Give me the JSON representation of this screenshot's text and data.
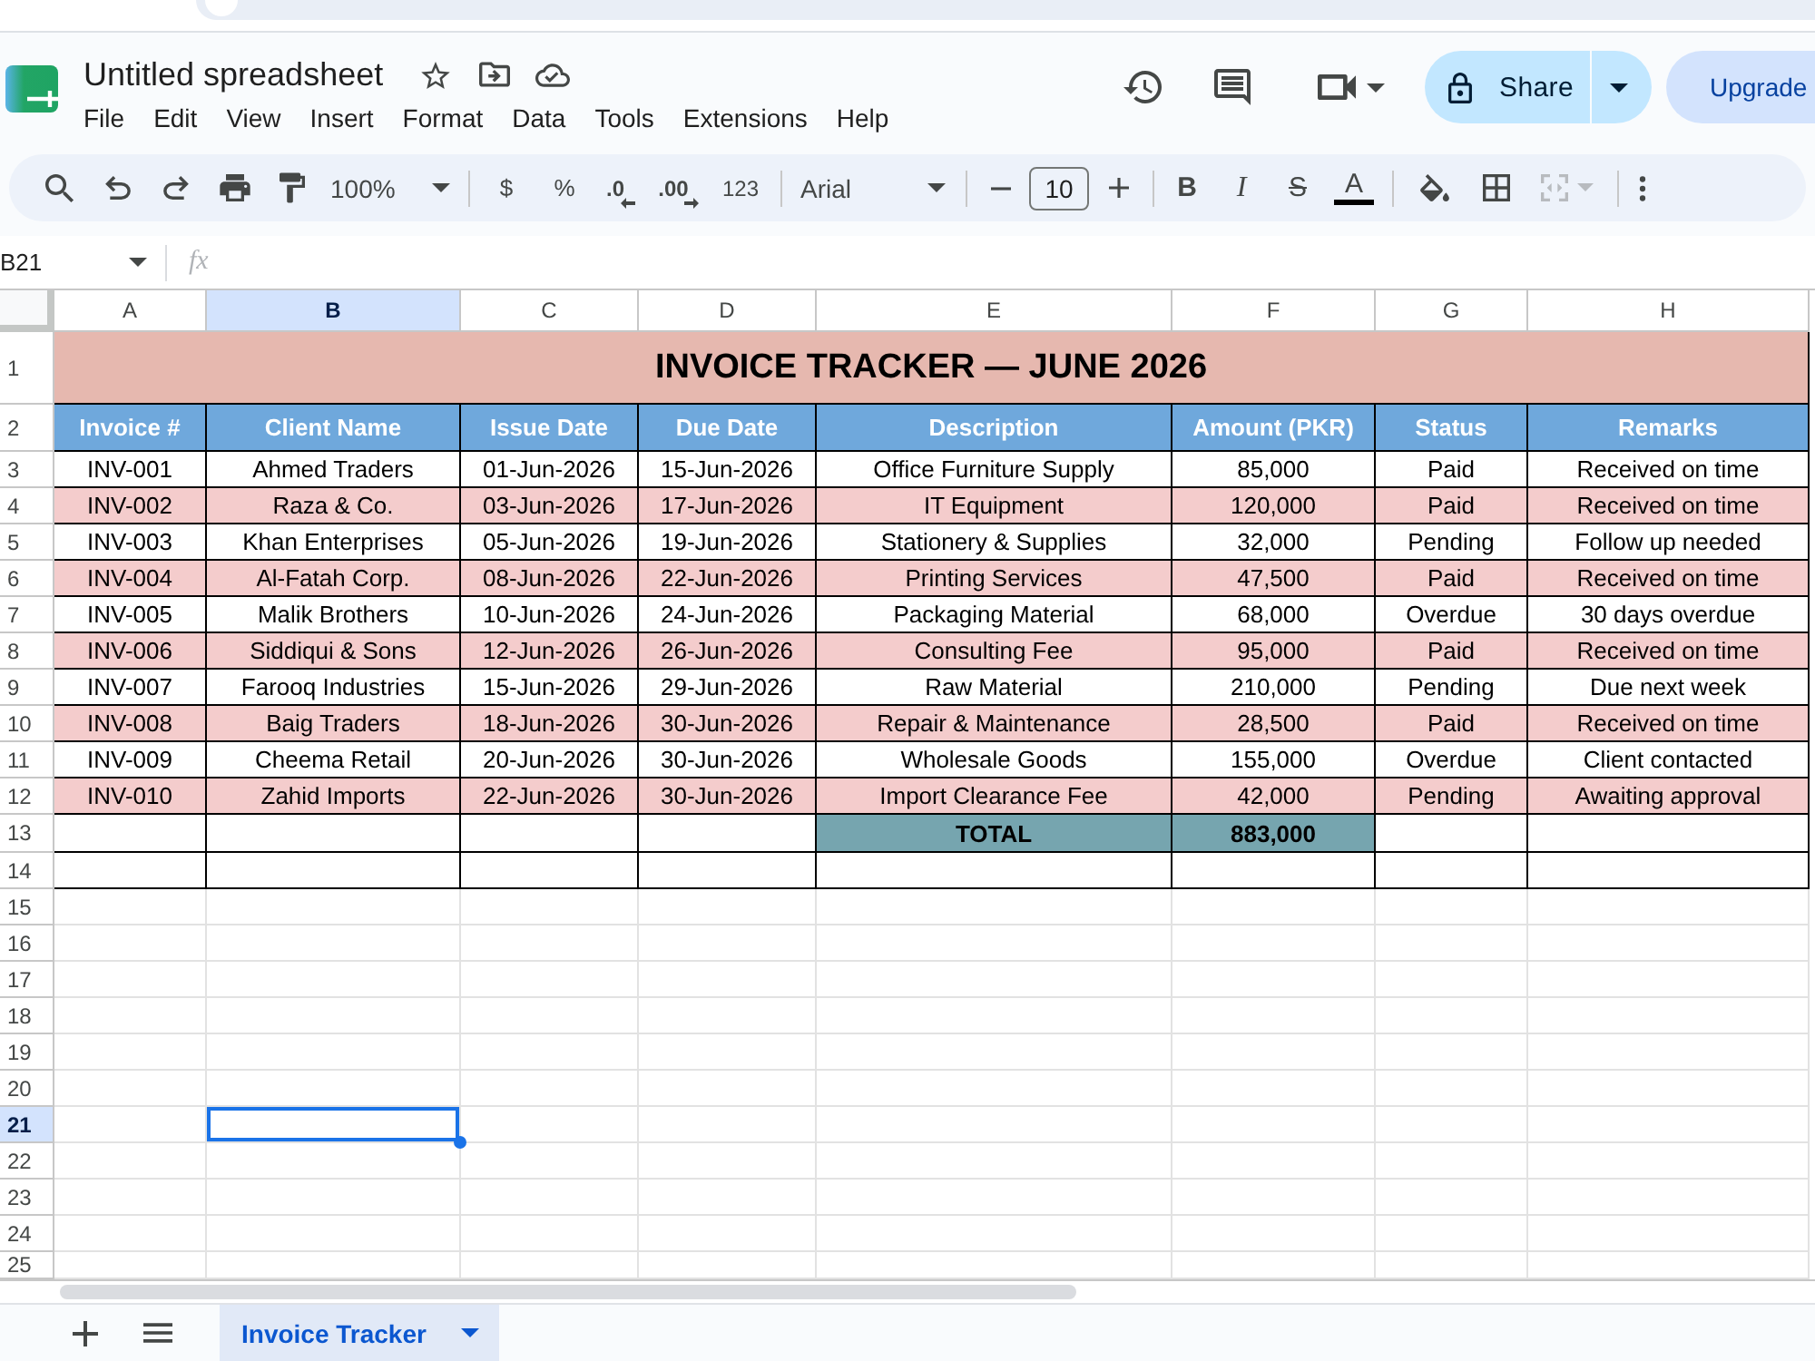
{
  "document": {
    "title": "Untitled spreadsheet"
  },
  "menu": [
    "File",
    "Edit",
    "View",
    "Insert",
    "Format",
    "Data",
    "Tools",
    "Extensions",
    "Help"
  ],
  "header_buttons": {
    "share": "Share",
    "upgrade": "Upgrade"
  },
  "toolbar": {
    "zoom": "100%",
    "currency": "$",
    "percent": "%",
    "decrease_decimal": ".0",
    "increase_decimal": ".00",
    "number_format": "123",
    "font": "Arial",
    "font_size": "10",
    "bold": "B",
    "italic": "I",
    "strikethrough": "S",
    "text_color": "A",
    "merge": {
      "disabled": true
    }
  },
  "formula_bar": {
    "cell": "B21",
    "label": "fx"
  },
  "columns": [
    {
      "label": "A",
      "selected": false
    },
    {
      "label": "B",
      "selected": true
    },
    {
      "label": "C",
      "selected": false
    },
    {
      "label": "D",
      "selected": false
    },
    {
      "label": "E",
      "selected": false
    },
    {
      "label": "F",
      "selected": false
    },
    {
      "label": "G",
      "selected": false
    },
    {
      "label": "H",
      "selected": false
    }
  ],
  "row_numbers": [
    {
      "label": "1",
      "selected": false
    },
    {
      "label": "2",
      "selected": false
    },
    {
      "label": "3",
      "selected": false
    },
    {
      "label": "4",
      "selected": false
    },
    {
      "label": "5",
      "selected": false
    },
    {
      "label": "6",
      "selected": false
    },
    {
      "label": "7",
      "selected": false
    },
    {
      "label": "8",
      "selected": false
    },
    {
      "label": "9",
      "selected": false
    },
    {
      "label": "10",
      "selected": false
    },
    {
      "label": "11",
      "selected": false
    },
    {
      "label": "12",
      "selected": false
    },
    {
      "label": "13",
      "selected": false
    },
    {
      "label": "14",
      "selected": false
    },
    {
      "label": "15",
      "selected": false
    },
    {
      "label": "16",
      "selected": false
    },
    {
      "label": "17",
      "selected": false
    },
    {
      "label": "18",
      "selected": false
    },
    {
      "label": "19",
      "selected": false
    },
    {
      "label": "20",
      "selected": false
    },
    {
      "label": "21",
      "selected": true
    },
    {
      "label": "22",
      "selected": false
    },
    {
      "label": "23",
      "selected": false
    },
    {
      "label": "24",
      "selected": false
    },
    {
      "label": "25",
      "selected": false
    }
  ],
  "invoice_table": {
    "title": "INVOICE TRACKER — JUNE 2026",
    "headers": [
      "Invoice #",
      "Client Name",
      "Issue Date",
      "Due Date",
      "Description",
      "Amount (PKR)",
      "Status",
      "Remarks"
    ],
    "rows": [
      [
        "INV-001",
        "Ahmed Traders",
        "01-Jun-2026",
        "15-Jun-2026",
        "Office Furniture Supply",
        "85,000",
        "Paid",
        "Received on time"
      ],
      [
        "INV-002",
        "Raza & Co.",
        "03-Jun-2026",
        "17-Jun-2026",
        "IT Equipment",
        "120,000",
        "Paid",
        "Received on time"
      ],
      [
        "INV-003",
        "Khan Enterprises",
        "05-Jun-2026",
        "19-Jun-2026",
        "Stationery & Supplies",
        "32,000",
        "Pending",
        "Follow up needed"
      ],
      [
        "INV-004",
        "Al-Fatah Corp.",
        "08-Jun-2026",
        "22-Jun-2026",
        "Printing Services",
        "47,500",
        "Paid",
        "Received on time"
      ],
      [
        "INV-005",
        "Malik Brothers",
        "10-Jun-2026",
        "24-Jun-2026",
        "Packaging Material",
        "68,000",
        "Overdue",
        "30 days overdue"
      ],
      [
        "INV-006",
        "Siddiqui & Sons",
        "12-Jun-2026",
        "26-Jun-2026",
        "Consulting Fee",
        "95,000",
        "Paid",
        "Received on time"
      ],
      [
        "INV-007",
        "Farooq Industries",
        "15-Jun-2026",
        "29-Jun-2026",
        "Raw Material",
        "210,000",
        "Pending",
        "Due next week"
      ],
      [
        "INV-008",
        "Baig Traders",
        "18-Jun-2026",
        "30-Jun-2026",
        "Repair & Maintenance",
        "28,500",
        "Paid",
        "Received on time"
      ],
      [
        "INV-009",
        "Cheema Retail",
        "20-Jun-2026",
        "30-Jun-2026",
        "Wholesale Goods",
        "155,000",
        "Overdue",
        "Client contacted"
      ],
      [
        "INV-010",
        "Zahid Imports",
        "22-Jun-2026",
        "30-Jun-2026",
        "Import Clearance Fee",
        "42,000",
        "Pending",
        "Awaiting approval"
      ]
    ],
    "total": {
      "label": "TOTAL",
      "amount": "883,000"
    }
  },
  "sheet_tabs": [
    {
      "label": "Invoice Tracker",
      "selected": true
    }
  ]
}
